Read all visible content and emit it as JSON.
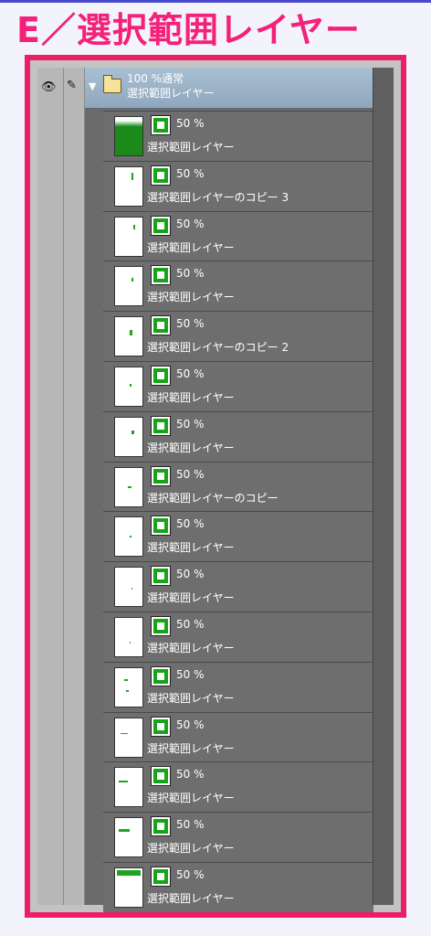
{
  "heading": "E／選択範囲レイヤー",
  "folder": {
    "blend": "100 %通常",
    "name": "選択範囲レイヤー"
  },
  "layers": [
    {
      "opacity": "50 %",
      "name": "選択範囲レイヤー",
      "thumb": "full"
    },
    {
      "opacity": "50 %",
      "name": "選択範囲レイヤーのコピー 3"
    },
    {
      "opacity": "50 %",
      "name": "選択範囲レイヤー"
    },
    {
      "opacity": "50 %",
      "name": "選択範囲レイヤー"
    },
    {
      "opacity": "50 %",
      "name": "選択範囲レイヤーのコピー 2"
    },
    {
      "opacity": "50 %",
      "name": "選択範囲レイヤー"
    },
    {
      "opacity": "50 %",
      "name": "選択範囲レイヤー"
    },
    {
      "opacity": "50 %",
      "name": "選択範囲レイヤーのコピー"
    },
    {
      "opacity": "50 %",
      "name": "選択範囲レイヤー"
    },
    {
      "opacity": "50 %",
      "name": "選択範囲レイヤー"
    },
    {
      "opacity": "50 %",
      "name": "選択範囲レイヤー"
    },
    {
      "opacity": "50 %",
      "name": "選択範囲レイヤー"
    },
    {
      "opacity": "50 %",
      "name": "選択範囲レイヤー"
    },
    {
      "opacity": "50 %",
      "name": "選択範囲レイヤー"
    },
    {
      "opacity": "50 %",
      "name": "選択範囲レイヤー"
    },
    {
      "opacity": "50 %",
      "name": "選択範囲レイヤー"
    }
  ],
  "icons": {
    "visibility": "eye-icon",
    "edit": "pen-icon",
    "expand": "caret-down-icon",
    "folder": "folder-icon",
    "selection": "selection-layer-icon"
  },
  "colors": {
    "heading": "#f4217a",
    "frame": "#ee1e66",
    "folder_row": "#a9bfd4",
    "selection_green": "#17a317"
  }
}
